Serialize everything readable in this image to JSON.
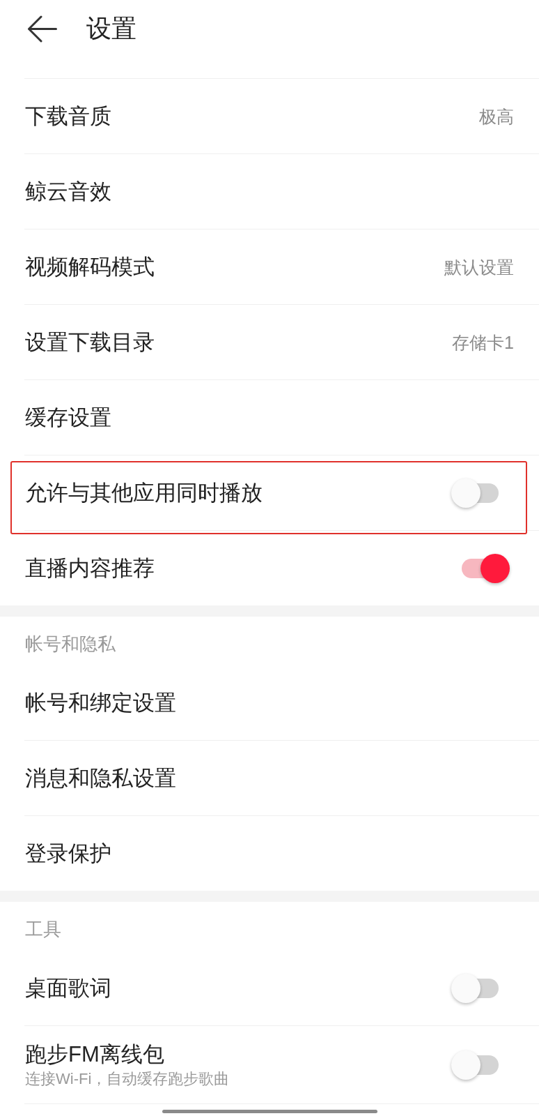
{
  "header": {
    "title": "设置"
  },
  "sections": [
    {
      "items": [
        {
          "kind": "value",
          "label": "下载音质",
          "value": "极高",
          "highlighted": false
        },
        {
          "kind": "link",
          "label": "鲸云音效",
          "highlighted": false
        },
        {
          "kind": "value",
          "label": "视频解码模式",
          "value": "默认设置",
          "highlighted": false
        },
        {
          "kind": "value",
          "label": "设置下载目录",
          "value": "存储卡1",
          "highlighted": false
        },
        {
          "kind": "link",
          "label": "缓存设置",
          "highlighted": false
        },
        {
          "kind": "toggle",
          "label": "允许与其他应用同时播放",
          "on": false,
          "highlighted": true
        },
        {
          "kind": "toggle",
          "label": "直播内容推荐",
          "on": true,
          "highlighted": false
        }
      ]
    },
    {
      "title": "帐号和隐私",
      "items": [
        {
          "kind": "link",
          "label": "帐号和绑定设置",
          "highlighted": false
        },
        {
          "kind": "link",
          "label": "消息和隐私设置",
          "highlighted": false
        },
        {
          "kind": "link",
          "label": "登录保护",
          "highlighted": false
        }
      ]
    },
    {
      "title": "工具",
      "items": [
        {
          "kind": "toggle",
          "label": "桌面歌词",
          "on": false,
          "highlighted": false
        },
        {
          "kind": "toggle",
          "label": "跑步FM离线包",
          "subtitle": "连接Wi-Fi，自动缓存跑步歌曲",
          "on": false,
          "highlighted": false
        }
      ]
    }
  ]
}
